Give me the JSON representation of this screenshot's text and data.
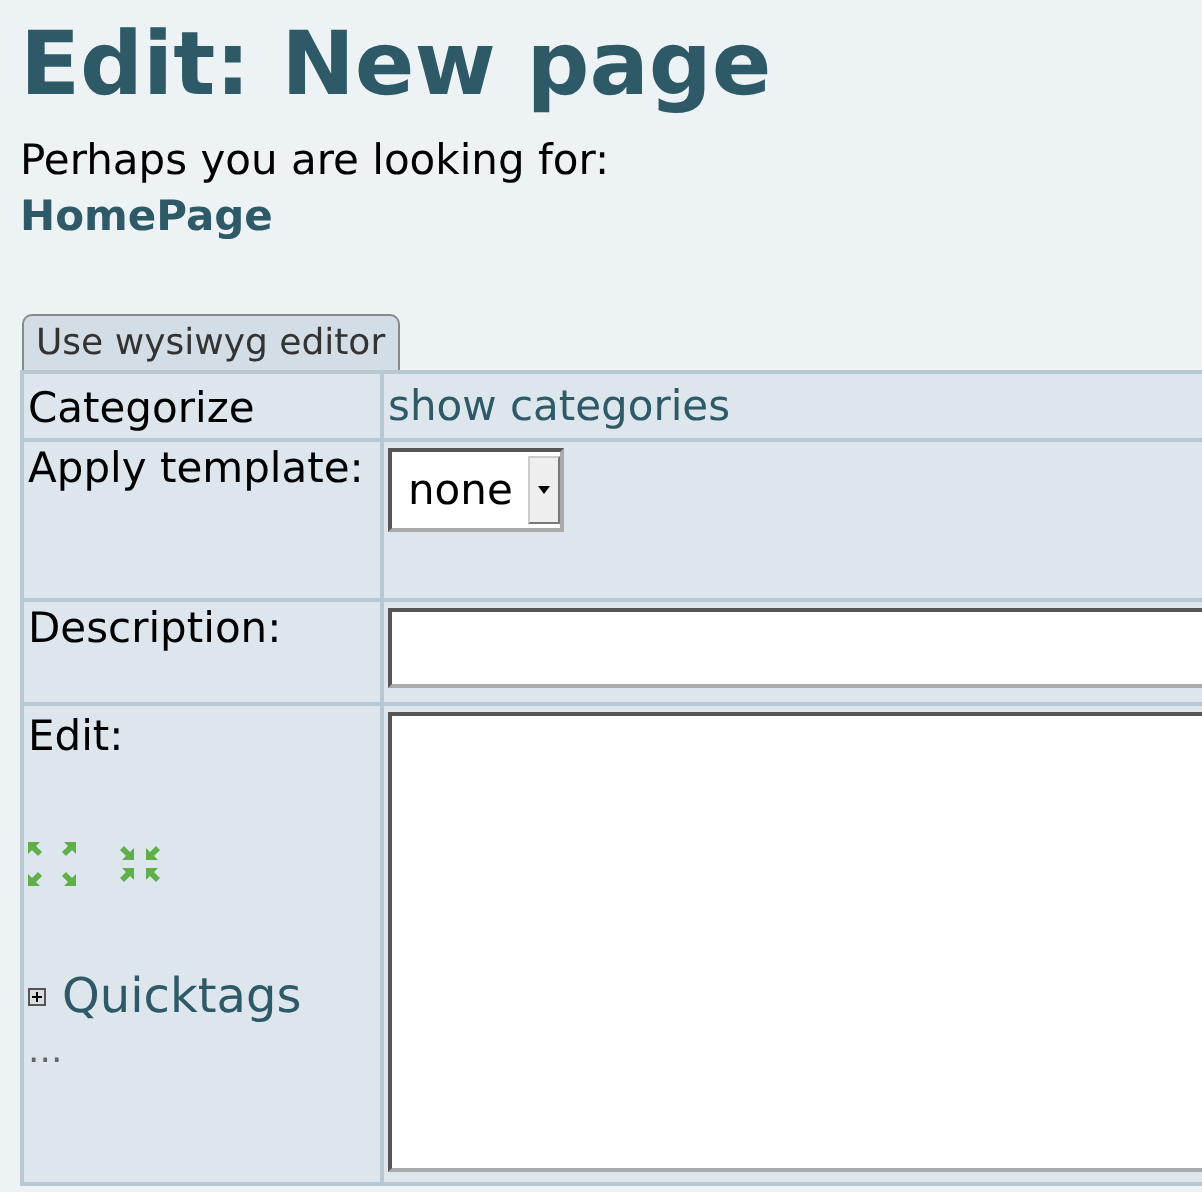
{
  "page": {
    "title": "Edit: New page",
    "suggestion": "Perhaps you are looking for:",
    "suggested_link": "HomePage"
  },
  "editor_tab": {
    "label": "Use wysiwyg editor"
  },
  "form": {
    "categorize": {
      "label": "Categorize",
      "link": "show categories"
    },
    "template": {
      "label": "Apply template:",
      "value": "none"
    },
    "description": {
      "label": "Description:"
    },
    "edit": {
      "label": "Edit:",
      "quicktags": {
        "label": "Quicktags",
        "expanded": false
      },
      "more": "..."
    }
  }
}
